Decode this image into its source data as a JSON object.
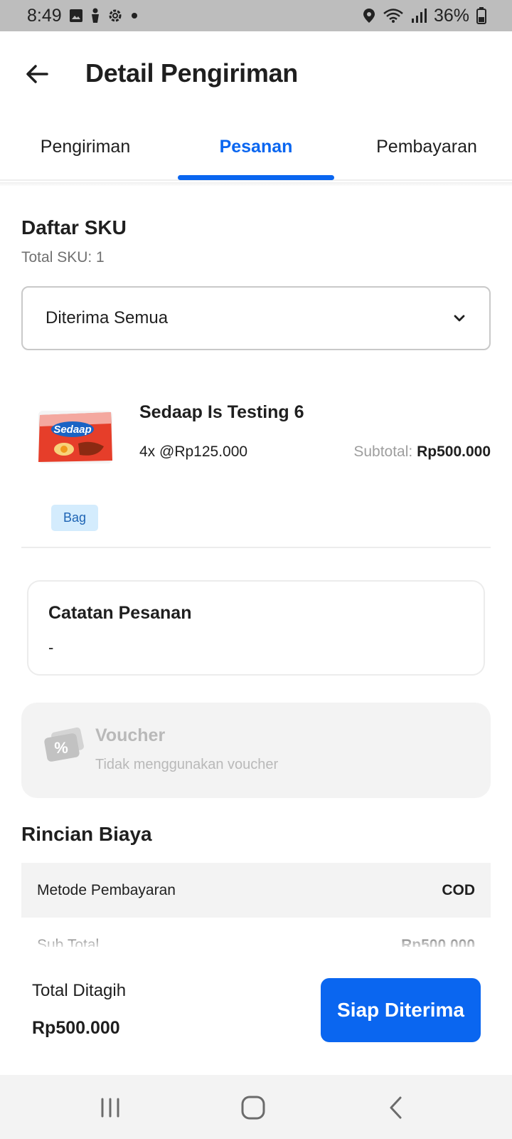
{
  "status_bar": {
    "time": "8:49",
    "battery": "36%"
  },
  "header": {
    "title": "Detail Pengiriman"
  },
  "tabs": [
    {
      "label": "Pengiriman",
      "active": false
    },
    {
      "label": "Pesanan",
      "active": true
    },
    {
      "label": "Pembayaran",
      "active": false
    }
  ],
  "sku_section": {
    "title": "Daftar SKU",
    "total": "Total SKU: 1",
    "filter_selected": "Diterima Semua"
  },
  "product": {
    "name": "Sedaap Is Testing 6",
    "qty_price": "4x @Rp125.000",
    "subtotal_label": "Subtotal:",
    "subtotal_value": "Rp500.000",
    "tag": "Bag",
    "image_brand": "Sedaap"
  },
  "notes": {
    "title": "Catatan Pesanan",
    "value": "-"
  },
  "voucher": {
    "title": "Voucher",
    "subtitle": "Tidak menggunakan voucher"
  },
  "cost": {
    "title": "Rincian Biaya",
    "rows": [
      {
        "label": "Metode Pembayaran",
        "value": "COD"
      },
      {
        "label": "Sub Total",
        "value": "Rp500.000"
      }
    ]
  },
  "footer": {
    "total_label": "Total Ditagih",
    "total_value": "Rp500.000",
    "action_label": "Siap Diterima"
  },
  "colors": {
    "accent": "#0a66f0",
    "tag_bg": "#d4ecfd",
    "tag_text": "#1e64b4"
  }
}
